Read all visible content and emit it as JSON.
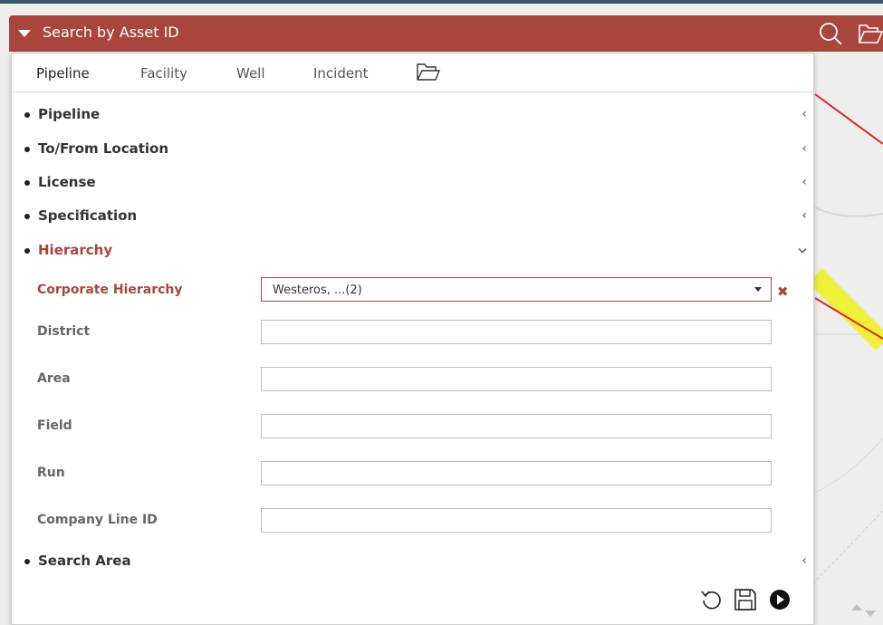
{
  "header": {
    "title": "Search by Asset ID"
  },
  "tabs": [
    {
      "label": "Pipeline"
    },
    {
      "label": "Facility"
    },
    {
      "label": "Well"
    },
    {
      "label": "Incident"
    }
  ],
  "sections": [
    {
      "label": "Pipeline"
    },
    {
      "label": "To/From Location"
    },
    {
      "label": "License"
    },
    {
      "label": "Specification"
    },
    {
      "label": "Hierarchy"
    },
    {
      "label": "Search Area"
    }
  ],
  "hierarchy": {
    "corporate_label": "Corporate Hierarchy",
    "corporate_value": "Westeros, ...(2)",
    "district_label": "District",
    "area_label": "Area",
    "field_label": "Field",
    "run_label": "Run",
    "company_line_label": "Company Line ID"
  },
  "colors": {
    "accent": "#a8463e",
    "map_red": "#e0242a",
    "map_yellow": "#f2f02a"
  }
}
